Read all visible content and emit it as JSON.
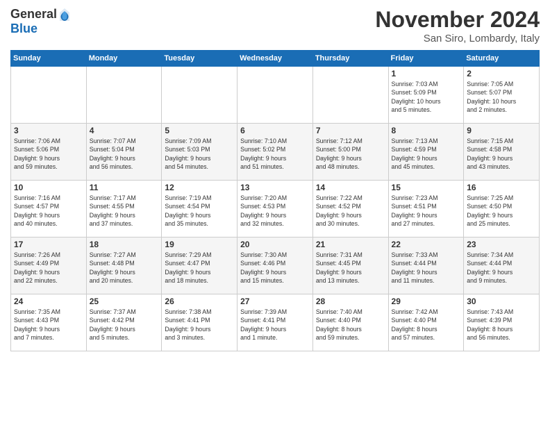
{
  "logo": {
    "general": "General",
    "blue": "Blue"
  },
  "title": "November 2024",
  "location": "San Siro, Lombardy, Italy",
  "header_days": [
    "Sunday",
    "Monday",
    "Tuesday",
    "Wednesday",
    "Thursday",
    "Friday",
    "Saturday"
  ],
  "weeks": [
    {
      "days": [
        {
          "num": "",
          "info": ""
        },
        {
          "num": "",
          "info": ""
        },
        {
          "num": "",
          "info": ""
        },
        {
          "num": "",
          "info": ""
        },
        {
          "num": "",
          "info": ""
        },
        {
          "num": "1",
          "info": "Sunrise: 7:03 AM\nSunset: 5:09 PM\nDaylight: 10 hours\nand 5 minutes."
        },
        {
          "num": "2",
          "info": "Sunrise: 7:05 AM\nSunset: 5:07 PM\nDaylight: 10 hours\nand 2 minutes."
        }
      ]
    },
    {
      "days": [
        {
          "num": "3",
          "info": "Sunrise: 7:06 AM\nSunset: 5:06 PM\nDaylight: 9 hours\nand 59 minutes."
        },
        {
          "num": "4",
          "info": "Sunrise: 7:07 AM\nSunset: 5:04 PM\nDaylight: 9 hours\nand 56 minutes."
        },
        {
          "num": "5",
          "info": "Sunrise: 7:09 AM\nSunset: 5:03 PM\nDaylight: 9 hours\nand 54 minutes."
        },
        {
          "num": "6",
          "info": "Sunrise: 7:10 AM\nSunset: 5:02 PM\nDaylight: 9 hours\nand 51 minutes."
        },
        {
          "num": "7",
          "info": "Sunrise: 7:12 AM\nSunset: 5:00 PM\nDaylight: 9 hours\nand 48 minutes."
        },
        {
          "num": "8",
          "info": "Sunrise: 7:13 AM\nSunset: 4:59 PM\nDaylight: 9 hours\nand 45 minutes."
        },
        {
          "num": "9",
          "info": "Sunrise: 7:15 AM\nSunset: 4:58 PM\nDaylight: 9 hours\nand 43 minutes."
        }
      ]
    },
    {
      "days": [
        {
          "num": "10",
          "info": "Sunrise: 7:16 AM\nSunset: 4:57 PM\nDaylight: 9 hours\nand 40 minutes."
        },
        {
          "num": "11",
          "info": "Sunrise: 7:17 AM\nSunset: 4:55 PM\nDaylight: 9 hours\nand 37 minutes."
        },
        {
          "num": "12",
          "info": "Sunrise: 7:19 AM\nSunset: 4:54 PM\nDaylight: 9 hours\nand 35 minutes."
        },
        {
          "num": "13",
          "info": "Sunrise: 7:20 AM\nSunset: 4:53 PM\nDaylight: 9 hours\nand 32 minutes."
        },
        {
          "num": "14",
          "info": "Sunrise: 7:22 AM\nSunset: 4:52 PM\nDaylight: 9 hours\nand 30 minutes."
        },
        {
          "num": "15",
          "info": "Sunrise: 7:23 AM\nSunset: 4:51 PM\nDaylight: 9 hours\nand 27 minutes."
        },
        {
          "num": "16",
          "info": "Sunrise: 7:25 AM\nSunset: 4:50 PM\nDaylight: 9 hours\nand 25 minutes."
        }
      ]
    },
    {
      "days": [
        {
          "num": "17",
          "info": "Sunrise: 7:26 AM\nSunset: 4:49 PM\nDaylight: 9 hours\nand 22 minutes."
        },
        {
          "num": "18",
          "info": "Sunrise: 7:27 AM\nSunset: 4:48 PM\nDaylight: 9 hours\nand 20 minutes."
        },
        {
          "num": "19",
          "info": "Sunrise: 7:29 AM\nSunset: 4:47 PM\nDaylight: 9 hours\nand 18 minutes."
        },
        {
          "num": "20",
          "info": "Sunrise: 7:30 AM\nSunset: 4:46 PM\nDaylight: 9 hours\nand 15 minutes."
        },
        {
          "num": "21",
          "info": "Sunrise: 7:31 AM\nSunset: 4:45 PM\nDaylight: 9 hours\nand 13 minutes."
        },
        {
          "num": "22",
          "info": "Sunrise: 7:33 AM\nSunset: 4:44 PM\nDaylight: 9 hours\nand 11 minutes."
        },
        {
          "num": "23",
          "info": "Sunrise: 7:34 AM\nSunset: 4:44 PM\nDaylight: 9 hours\nand 9 minutes."
        }
      ]
    },
    {
      "days": [
        {
          "num": "24",
          "info": "Sunrise: 7:35 AM\nSunset: 4:43 PM\nDaylight: 9 hours\nand 7 minutes."
        },
        {
          "num": "25",
          "info": "Sunrise: 7:37 AM\nSunset: 4:42 PM\nDaylight: 9 hours\nand 5 minutes."
        },
        {
          "num": "26",
          "info": "Sunrise: 7:38 AM\nSunset: 4:41 PM\nDaylight: 9 hours\nand 3 minutes."
        },
        {
          "num": "27",
          "info": "Sunrise: 7:39 AM\nSunset: 4:41 PM\nDaylight: 9 hours\nand 1 minute."
        },
        {
          "num": "28",
          "info": "Sunrise: 7:40 AM\nSunset: 4:40 PM\nDaylight: 8 hours\nand 59 minutes."
        },
        {
          "num": "29",
          "info": "Sunrise: 7:42 AM\nSunset: 4:40 PM\nDaylight: 8 hours\nand 57 minutes."
        },
        {
          "num": "30",
          "info": "Sunrise: 7:43 AM\nSunset: 4:39 PM\nDaylight: 8 hours\nand 56 minutes."
        }
      ]
    }
  ]
}
